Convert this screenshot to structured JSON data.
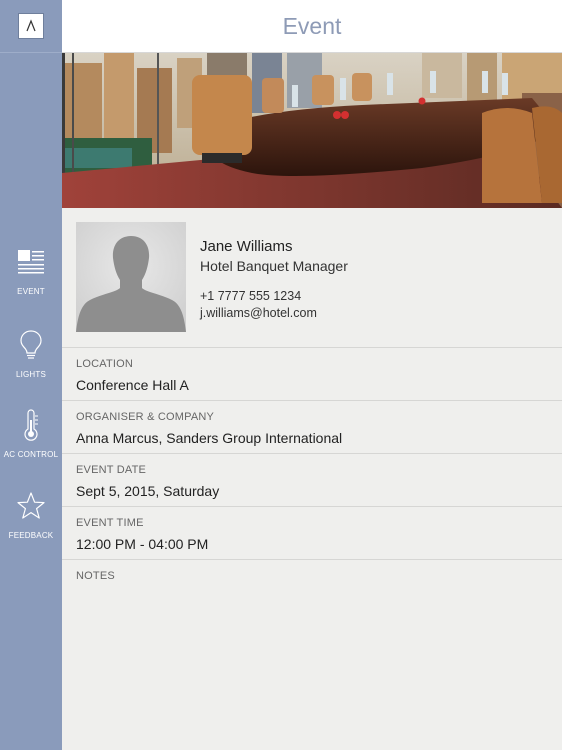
{
  "header": {
    "title": "Event"
  },
  "sidebar": {
    "items": [
      {
        "label": "EVENT",
        "icon": "event-icon"
      },
      {
        "label": "LIGHTS",
        "icon": "lightbulb-icon"
      },
      {
        "label": "AC CONTROL",
        "icon": "thermometer-icon"
      },
      {
        "label": "FEEDBACK",
        "icon": "star-icon"
      }
    ]
  },
  "contact": {
    "name": "Jane Williams",
    "role": "Hotel Banquet Manager",
    "phone": "+1 7777 555 1234",
    "email": "j.williams@hotel.com"
  },
  "fields": [
    {
      "label": "LOCATION",
      "value": "Conference Hall A"
    },
    {
      "label": "ORGANISER & COMPANY",
      "value": "Anna Marcus, Sanders Group International"
    },
    {
      "label": "EVENT DATE",
      "value": "Sept 5, 2015, Saturday"
    },
    {
      "label": "EVENT TIME",
      "value": "12:00 PM - 04:00 PM"
    },
    {
      "label": "NOTES",
      "value": ""
    }
  ],
  "colors": {
    "sidebar": "#8a9bbb",
    "title": "#8e9bb6",
    "content_bg": "#efefed"
  }
}
